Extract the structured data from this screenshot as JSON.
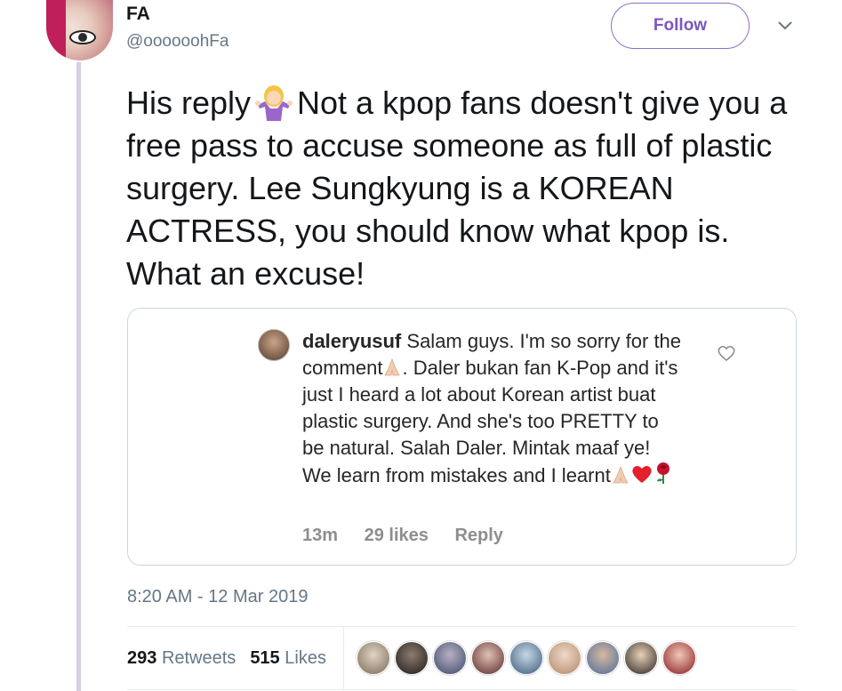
{
  "tweet": {
    "author_name": "FA",
    "author_handle": "@oooooohFa",
    "follow_label": "Follow",
    "text_before_emoji": "His reply",
    "text_after_emoji": "Not a kpop fans doesn't give you a free pass to accuse someone as full of plastic surgery. Lee Sungkyung is a KOREAN ACTRESS, you should know what kpop is. What an excuse!",
    "timestamp": "8:20 AM - 12 Mar 2019",
    "retweets_count": "293",
    "retweets_label": "Retweets",
    "likes_count": "515",
    "likes_label": "Likes"
  },
  "instagram_comment": {
    "username": "daleryusuf",
    "text_part1": "Salam guys. I'm so sorry for the comment",
    "text_part2": ". Daler bukan fan K-Pop and it's just I heard a lot about Korean artist buat plastic surgery. And she's too PRETTY to be natural. Salah Daler. Mintak maaf ye! We learn from mistakes and I learnt",
    "age": "13m",
    "likes": "29 likes",
    "reply_label": "Reply"
  },
  "icons": [
    "chevron-down-icon",
    "person-shrugging-emoji",
    "folded-hands-emoji",
    "heart-emoji",
    "rose-emoji",
    "heart-outline-icon"
  ],
  "colors": {
    "follow_accent": "#7b57be",
    "thread_line": "#d7cfe6",
    "secondary_text": "#657786",
    "ig_meta": "#8e8e8e"
  }
}
